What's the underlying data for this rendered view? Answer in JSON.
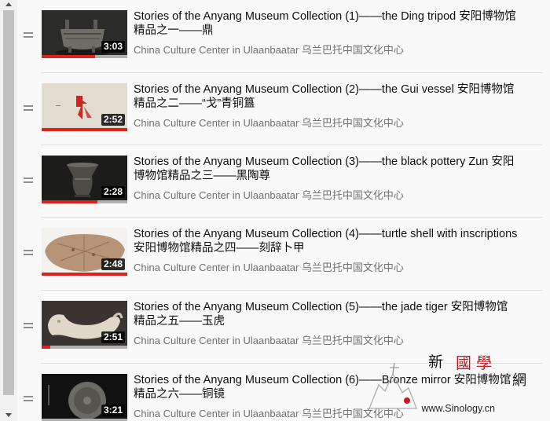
{
  "playlist": {
    "items": [
      {
        "title": "Stories of the Anyang Museum Collection (1)——the Ding tripod 安阳博物馆精品之一——鼎",
        "channel": "China Culture Center in Ulaanbaatar 乌兰巴托中国文化中心",
        "duration": "3:03",
        "watched_fraction": 0.62
      },
      {
        "title": "Stories of the Anyang Museum Collection (2)——the Gui vessel 安阳博物馆精品之二——“戈”青铜簋",
        "channel": "China Culture Center in Ulaanbaatar 乌兰巴托中国文化中心",
        "duration": "2:52",
        "watched_fraction": 1.0
      },
      {
        "title": "Stories of the Anyang Museum Collection (3)——the black pottery Zun 安阳博物馆精品之三——黑陶尊",
        "channel": "China Culture Center in Ulaanbaatar 乌兰巴托中国文化中心",
        "duration": "2:28",
        "watched_fraction": 0.65
      },
      {
        "title": "Stories of the Anyang Museum Collection (4)——turtle shell with inscriptions 安阳博物馆精品之四——刻辞卜甲",
        "channel": "China Culture Center in Ulaanbaatar 乌兰巴托中国文化中心",
        "duration": "2:48",
        "watched_fraction": 1.0
      },
      {
        "title": "Stories of the Anyang Museum Collection (5)——the jade tiger 安阳博物馆精品之五——玉虎",
        "channel": "China Culture Center in Ulaanbaatar 乌兰巴托中国文化中心",
        "duration": "2:51",
        "watched_fraction": 0.1
      },
      {
        "title": "Stories of the Anyang Museum Collection (6)——Bronze mirror 安阳博物馆精品之六——铜镜",
        "channel": "China Culture Center in Ulaanbaatar 乌兰巴托中国文化中心",
        "duration": "3:21",
        "watched_fraction": 0.0
      }
    ]
  },
  "watermark": {
    "char_1": "新",
    "char_2": "國學",
    "char_3": "網",
    "url": "www.Sinology.cn"
  },
  "colors": {
    "progress": "#e0201b",
    "duration_bg": "#000000",
    "channel_text": "#707070"
  }
}
